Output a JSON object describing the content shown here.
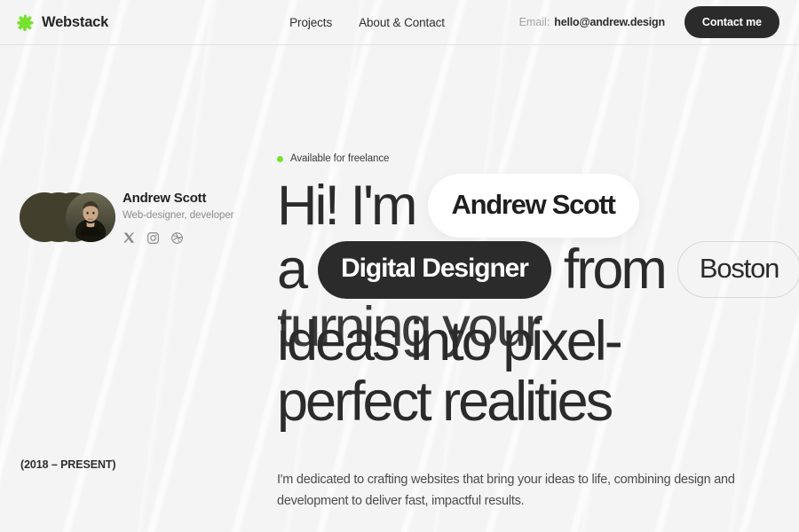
{
  "header": {
    "brand": {
      "name": "Webstack",
      "icon": "four-point-star-icon",
      "color": "#76e12f"
    },
    "nav": [
      {
        "label": "Projects"
      },
      {
        "label": "About & Contact"
      }
    ],
    "email": {
      "label": "Email:",
      "value": "hello@andrew.design"
    },
    "cta": {
      "label": "Contact me"
    }
  },
  "profile": {
    "name": "Andrew Scott",
    "role": "Web-designer, developer",
    "socials": [
      {
        "name": "x-icon",
        "label": "X"
      },
      {
        "name": "instagram-icon",
        "label": "Instagram"
      },
      {
        "name": "dribbble-icon",
        "label": "Dribbble"
      }
    ]
  },
  "years": "(2018 – PRESENT)",
  "hero": {
    "availability": "Available for freelance",
    "availability_dot_color": "#76e12f",
    "line1_word": "Hi! I'm",
    "pill_name": "Andrew Scott",
    "line2_word_a": "a",
    "pill_role": "Digital Designer",
    "line2_word_b": "from",
    "pill_city": "Boston",
    "line3_a": "turning your",
    "line3_b": "ideas into pixel-",
    "line4": "perfect realities",
    "blurb": "I'm dedicated to crafting websites that bring your ideas to life, combining design and development to deliver fast, impactful results."
  }
}
